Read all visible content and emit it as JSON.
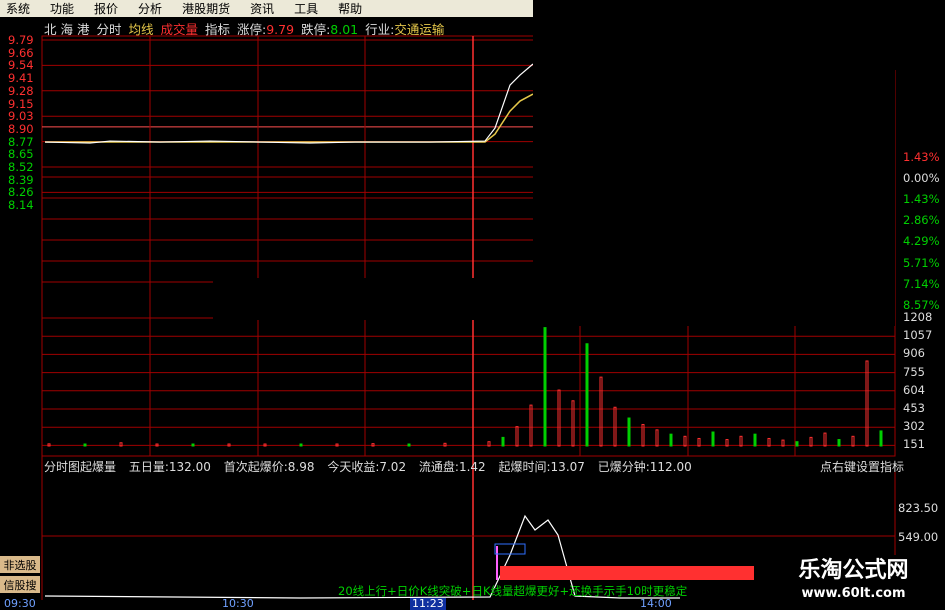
{
  "menu": [
    "系统",
    "功能",
    "报价",
    "分析",
    "港股期货",
    "资讯",
    "工具",
    "帮助"
  ],
  "header": {
    "stock_name": "北 海 港",
    "view_mode": "分时",
    "avg_line_label": "均线",
    "volume_label": "成交量",
    "indicator_label": "指标",
    "limit_up_label": "涨停:",
    "limit_up_value": "9.79",
    "limit_down_label": "跌停:",
    "limit_down_value": "8.01",
    "industry_label": "行业:",
    "industry_value": "交通运输"
  },
  "price_axis": {
    "left": [
      "9.79",
      "9.66",
      "9.54",
      "9.41",
      "9.28",
      "9.15",
      "9.03",
      "8.90",
      "8.77",
      "8.65",
      "8.52",
      "8.39",
      "8.26",
      "8.14"
    ],
    "right_pct": [
      "1.43%",
      "0.00%",
      "1.43%",
      "2.86%",
      "4.29%",
      "5.71%",
      "7.14%",
      "8.57%"
    ]
  },
  "volume_axis": [
    "1208",
    "1057",
    "906",
    "755",
    "604",
    "453",
    "302",
    "151"
  ],
  "indicator_bar": {
    "name": "分时图起爆量",
    "five_day_vol": "五日量:132.00",
    "first_burst_price": "首次起爆价:8.98",
    "today_gain": "今天收益:7.02",
    "float_shares": "流通盘:1.42",
    "burst_time": "起爆时间:13.07",
    "burst_minutes": "已爆分钟:112.00",
    "hint": "点右键设置指标"
  },
  "sub_axis": [
    "823.50",
    "549.00"
  ],
  "side_buttons": [
    "非选股",
    "信股搜"
  ],
  "signal_text": "20线上行+日价K线突破+日K线量超爆更好+还换手示手10时更稳定",
  "time_axis": [
    "09:30",
    "10:30",
    "11:23",
    "14:00"
  ],
  "watermark": {
    "title": "乐淘公式网",
    "url": "www.60lt.com"
  },
  "colors": {
    "up": "#ff3030",
    "down": "#00d000",
    "grid": "#a00000",
    "price_line": "#ffffff",
    "avg_line": "#e6c84a"
  },
  "chart_data": {
    "type": "line",
    "series": [
      {
        "name": "分时",
        "values": [
          8.77,
          8.76,
          8.78,
          8.77,
          8.78,
          8.77,
          8.76,
          8.77,
          8.77,
          8.77,
          8.78,
          8.91,
          9.34,
          9.44,
          9.55
        ]
      },
      {
        "name": "均线",
        "values": [
          8.77,
          8.77,
          8.77,
          8.77,
          8.77,
          8.77,
          8.77,
          8.77,
          8.77,
          8.77,
          8.77,
          8.85,
          9.08,
          9.18,
          9.25
        ]
      }
    ],
    "volumes": [
      20,
      15,
      30,
      10,
      12,
      8,
      18,
      14,
      10,
      22,
      12,
      25,
      40,
      80,
      180,
      380,
      1100,
      520,
      420,
      950,
      640,
      360,
      260,
      200,
      150,
      110,
      90,
      70,
      130,
      60,
      90,
      110,
      70,
      55,
      40,
      80,
      120,
      60,
      90,
      790,
      140
    ],
    "ylim": [
      8.01,
      9.79
    ]
  }
}
